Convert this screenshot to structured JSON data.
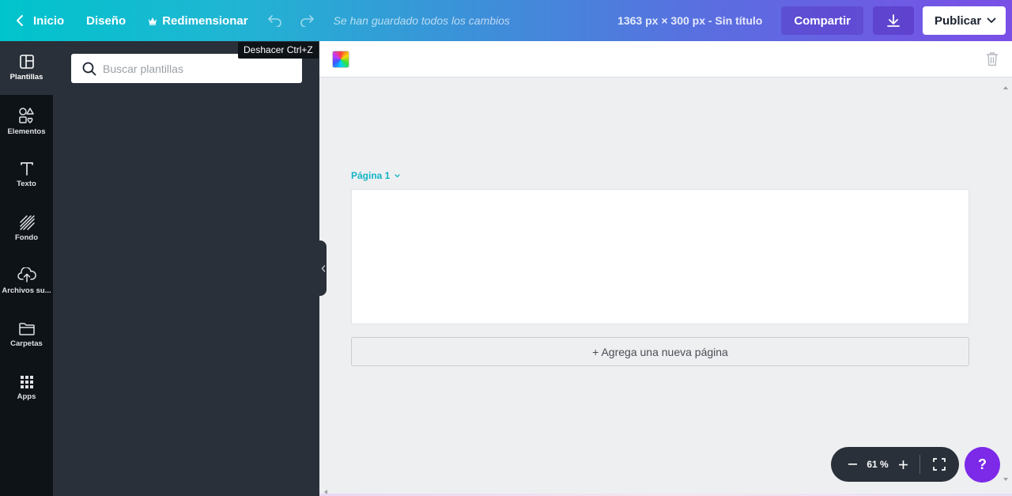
{
  "topbar": {
    "home_label": "Inicio",
    "design_label": "Diseño",
    "resize_label": "Redimensionar",
    "saved_status": "Se han guardado todos los cambios",
    "doc_info": "1363 px × 300 px - Sin título",
    "share_label": "Compartir",
    "publish_label": "Publicar"
  },
  "tooltip": {
    "text": "Deshacer Ctrl+Z"
  },
  "rail": {
    "items": [
      {
        "label": "Plantillas",
        "icon": "templates-icon"
      },
      {
        "label": "Elementos",
        "icon": "elements-icon"
      },
      {
        "label": "Texto",
        "icon": "text-icon"
      },
      {
        "label": "Fondo",
        "icon": "background-icon"
      },
      {
        "label": "Archivos su...",
        "icon": "upload-icon"
      },
      {
        "label": "Carpetas",
        "icon": "folder-icon"
      },
      {
        "label": "Apps",
        "icon": "apps-icon"
      }
    ]
  },
  "panel": {
    "search_placeholder": "Buscar plantillas"
  },
  "editor": {
    "page_label": "Página 1",
    "add_page_label": "+ Agrega una nueva página"
  },
  "zoom": {
    "value": "61 %"
  },
  "help": {
    "label": "?"
  },
  "colors": {
    "accent": "#00c4cc",
    "brand_purple": "#7c2ae8",
    "panel": "#293039",
    "rail": "#0e1318"
  }
}
